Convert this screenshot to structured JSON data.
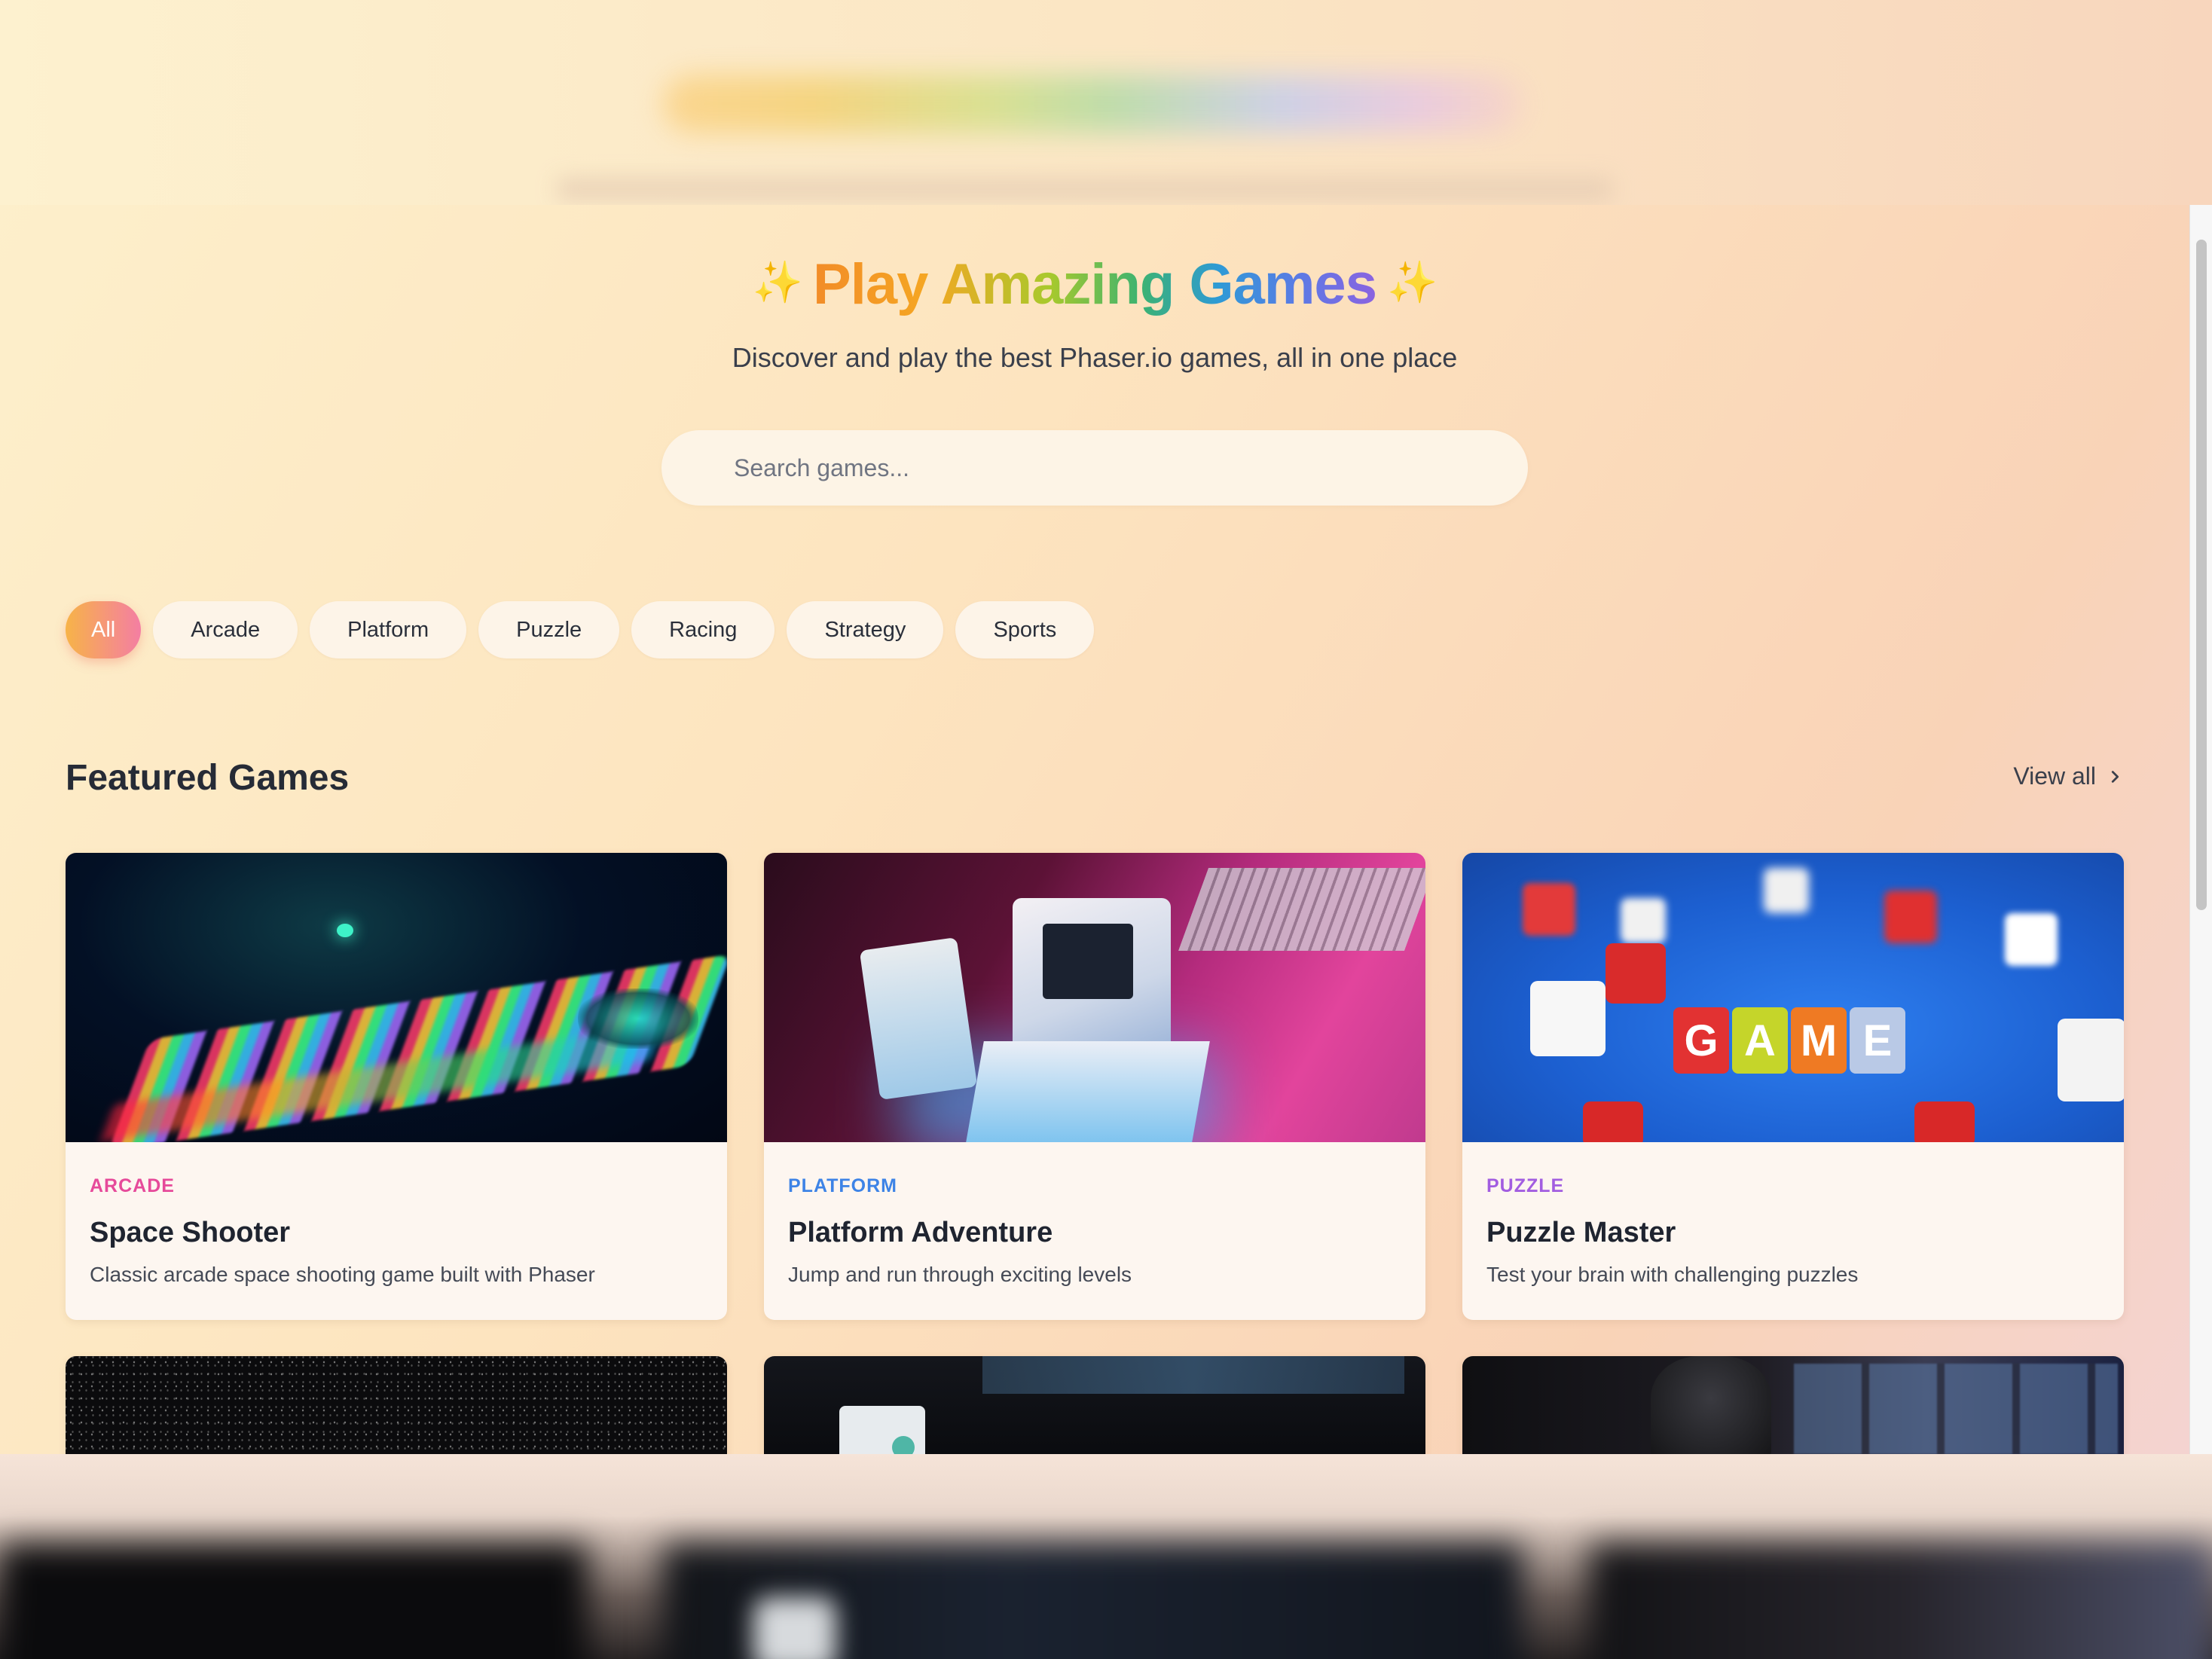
{
  "hero": {
    "title": "Play Amazing Games",
    "subtitle": "Discover and play the best Phaser.io games, all in one place"
  },
  "search": {
    "placeholder": "Search games..."
  },
  "categories": [
    "All",
    "Arcade",
    "Platform",
    "Puzzle",
    "Racing",
    "Strategy",
    "Sports"
  ],
  "selected_category": "All",
  "featured": {
    "title": "Featured Games",
    "view_all": "View all"
  },
  "games": [
    {
      "category": "ARCADE",
      "category_color": "#e64a9a",
      "name": "Space Shooter",
      "description": "Classic arcade space shooting game built with Phaser"
    },
    {
      "category": "PLATFORM",
      "category_color": "#3d83e6",
      "name": "Platform Adventure",
      "description": "Jump and run through exciting levels"
    },
    {
      "category": "PUZZLE",
      "category_color": "#a25de0",
      "name": "Puzzle Master",
      "description": "Test your brain with challenging puzzles"
    }
  ],
  "colors": {
    "accent_gradient_start": "#f7b348",
    "accent_gradient_end": "#f47ea3"
  },
  "icons": {
    "sparkle": "sparkle-icon",
    "chevron": "chevron-right-icon"
  },
  "puzzle_thumb_word": [
    "G",
    "A",
    "M",
    "E"
  ]
}
